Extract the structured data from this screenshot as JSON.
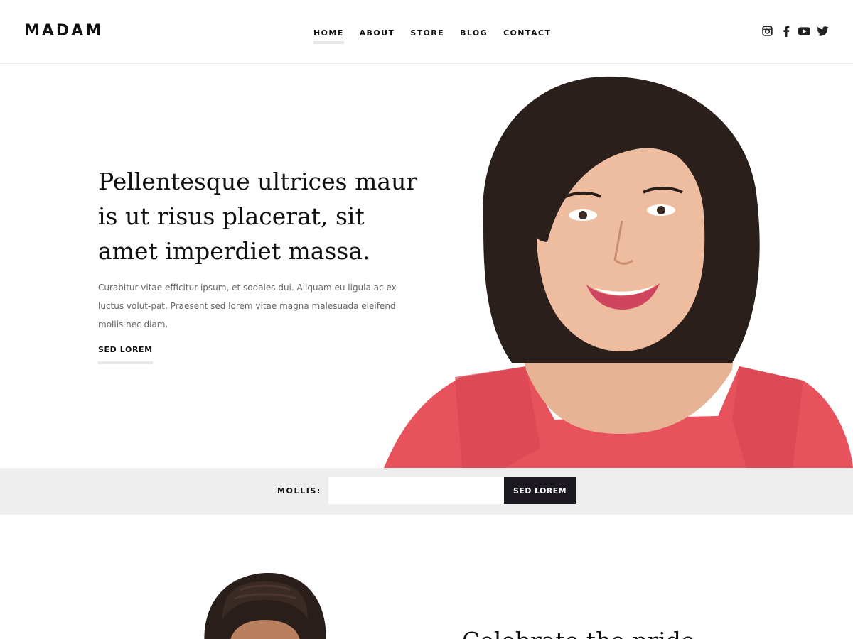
{
  "brand": {
    "logo": "MADAM"
  },
  "nav": {
    "items": [
      {
        "label": "HOME",
        "active": true
      },
      {
        "label": "ABOUT",
        "active": false
      },
      {
        "label": "STORE",
        "active": false
      },
      {
        "label": "BLOG",
        "active": false
      },
      {
        "label": "CONTACT",
        "active": false
      }
    ]
  },
  "social": {
    "icons": [
      "instagram-icon",
      "facebook-icon",
      "youtube-icon",
      "twitter-icon"
    ]
  },
  "hero": {
    "title": "Pellentesque ultrices maur is ut risus placerat, sit amet imperdiet massa.",
    "description": "Curabitur vitae efficitur ipsum, et sodales dui. Aliquam eu ligula ac ex luctus volut-pat. Praesent sed lorem vitae magna malesuada eleifend mollis nec diam.",
    "cta_label": "SED LOREM"
  },
  "newsletter": {
    "label": "MOLLIS:",
    "input_value": "",
    "button_label": "SED LOREM"
  },
  "section2": {
    "heading_partial": "Celebrate the pride",
    "photo": "woman-portrait-hair-up"
  },
  "colors": {
    "text": "#111111",
    "muted": "#666666",
    "bar_bg": "#eeeeee",
    "button_bg": "#1c1a20",
    "accent_shirt": "#e8525c"
  }
}
